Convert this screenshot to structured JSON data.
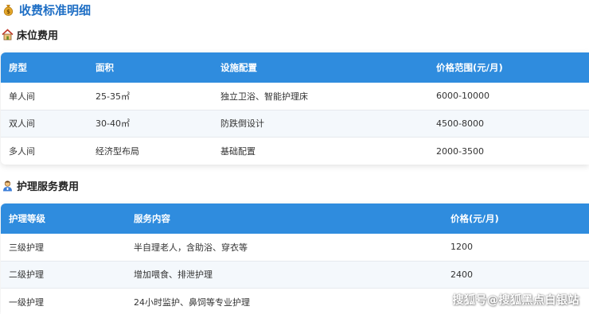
{
  "page_title": "收费标准明细",
  "icons": {
    "title": "money-bag-icon",
    "bed_section": "house-icon",
    "care_section": "caregiver-icon"
  },
  "colors": {
    "title_blue": "#1f6fc5",
    "header_blue": "#2f8cde",
    "alt_row": "#f4f8fc"
  },
  "bed_section": {
    "title": "床位费用",
    "headers": [
      "房型",
      "面积",
      "设施配置",
      "价格范围(元/月)"
    ],
    "rows": [
      [
        "单人间",
        "25-35㎡",
        "独立卫浴、智能护理床",
        "6000-10000"
      ],
      [
        "双人间",
        "30-40㎡",
        "防跌倒设计",
        "4500-8000"
      ],
      [
        "多人间",
        "经济型布局",
        "基础配置",
        "2000-3500"
      ]
    ]
  },
  "care_section": {
    "title": "护理服务费用",
    "headers": [
      "护理等级",
      "服务内容",
      "价格(元/月)"
    ],
    "rows": [
      [
        "三级护理",
        "半自理老人，含助浴、穿衣等",
        "1200"
      ],
      [
        "二级护理",
        "增加喂食、排泄护理",
        "2400"
      ],
      [
        "一级护理",
        "24小时监护、鼻饲等专业护理",
        ""
      ]
    ]
  },
  "watermark": "搜狐号@搜狐黑点白银站"
}
